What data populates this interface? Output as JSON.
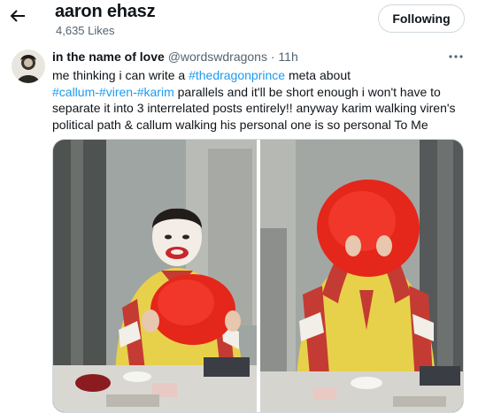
{
  "header": {
    "title": "aaron ehasz",
    "subtitle": "4,635 Likes",
    "follow_label": "Following"
  },
  "tweet": {
    "display_name": "in the name of love",
    "handle": "@wordswdragons",
    "separator": "·",
    "time": "11h",
    "text_segments": {
      "l1_a": "me thinking i can write a ",
      "l1_tag": "#thedragonprince",
      "l1_b": " meta about",
      "l2_tag1": "#callum",
      "l2_dash1": "-",
      "l2_tag2": "#viren",
      "l2_dash2": "-",
      "l2_tag3": "#karim",
      "l2_b": " parallels and it'll be short enough i won't have to",
      "l3": "separate it into 3 interrelated posts entirely!! anyway karim walking viren's",
      "l4": "political path & callum walking his personal one is so personal To Me"
    }
  },
  "icons": {
    "back": "arrow-left-icon",
    "more": "more-dots-icon"
  },
  "colors": {
    "link": "#1d9bf0",
    "secondary_text": "#536471",
    "border": "#cfd9de"
  }
}
